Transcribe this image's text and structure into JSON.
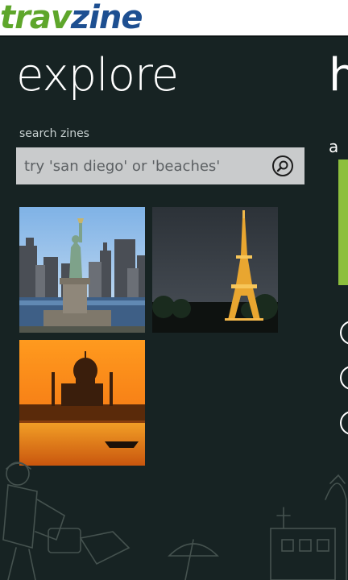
{
  "app": {
    "logo_part1": "trav",
    "logo_part2": "zine",
    "brand_green": "#5ea62b",
    "brand_blue": "#1d4f91"
  },
  "panorama": {
    "title": "explore",
    "next_title_peek": "h",
    "next_label_peek": "a"
  },
  "search": {
    "label": "search zines",
    "placeholder": "try 'san diego' or 'beaches'",
    "button_icon": "search-icon"
  },
  "destinations": [
    {
      "icon": "statue-of-liberty-photo"
    },
    {
      "icon": "eiffel-tower-photo"
    },
    {
      "icon": "taj-mahal-photo"
    }
  ],
  "colors": {
    "background": "#172323",
    "accent": "#8dbf3d",
    "search_bg": "#c9cbcc"
  }
}
